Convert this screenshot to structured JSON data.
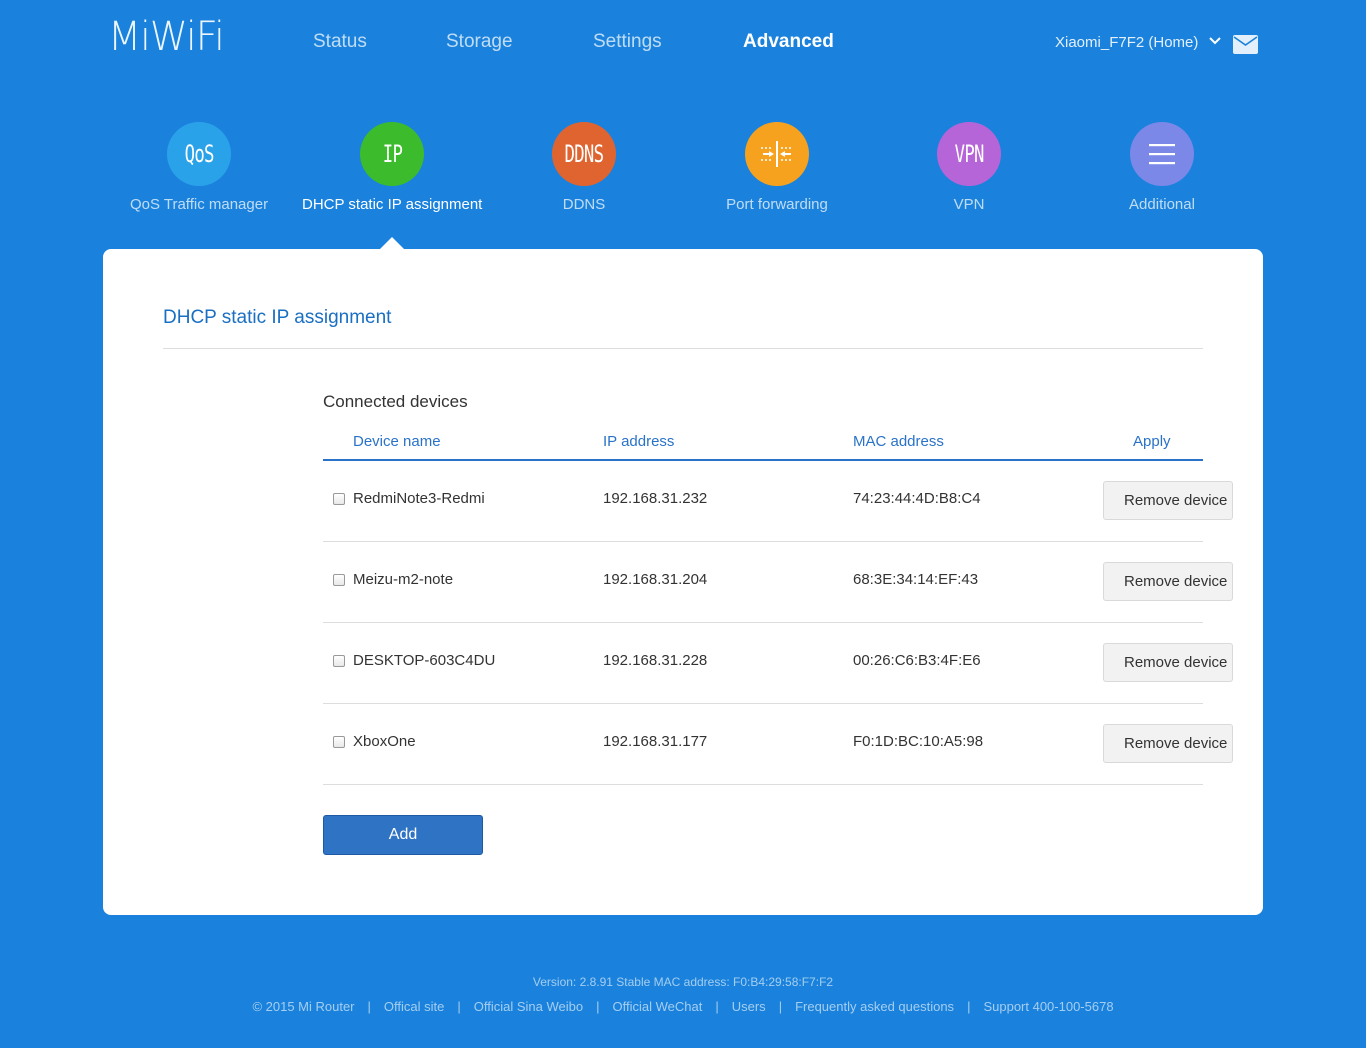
{
  "header": {
    "logo": "MiWiFi",
    "nav": [
      {
        "label": "Status"
      },
      {
        "label": "Storage"
      },
      {
        "label": "Settings"
      },
      {
        "label": "Advanced",
        "active": true
      }
    ],
    "router_name": "Xiaomi_F7F2 (Home)",
    "mail_icon": "mail-icon"
  },
  "features": [
    {
      "icon_text": "QoS",
      "label": "QoS Traffic manager",
      "color": "#2aa2ea"
    },
    {
      "icon_text": "IP",
      "label": "DHCP static IP assignment",
      "color": "#3cbb2c",
      "active": true
    },
    {
      "icon_text": "DDNS",
      "label": "DDNS",
      "color": "#e06430"
    },
    {
      "icon_text": "",
      "label": "Port forwarding",
      "color": "#f7a21f",
      "icon": "port-forwarding-icon"
    },
    {
      "icon_text": "VPN",
      "label": "VPN",
      "color": "#b565d8"
    },
    {
      "icon_text": "",
      "label": "Additional",
      "color": "#7b88e8",
      "icon": "menu-icon"
    }
  ],
  "card": {
    "title": "DHCP static IP assignment",
    "section_title": "Connected devices",
    "columns": [
      "Device name",
      "IP address",
      "MAC address",
      "Apply"
    ],
    "devices": [
      {
        "name": "RedmiNote3-Redmi",
        "ip": "192.168.31.232",
        "mac": "74:23:44:4D:B8:C4",
        "action": "Remove device"
      },
      {
        "name": "Meizu-m2-note",
        "ip": "192.168.31.204",
        "mac": "68:3E:34:14:EF:43",
        "action": "Remove device"
      },
      {
        "name": "DESKTOP-603C4DU",
        "ip": "192.168.31.228",
        "mac": "00:26:C6:B3:4F:E6",
        "action": "Remove device"
      },
      {
        "name": "XboxOne",
        "ip": "192.168.31.177",
        "mac": "F0:1D:BC:10:A5:98",
        "action": "Remove device"
      }
    ],
    "add_label": "Add"
  },
  "footer": {
    "version": "Version: 2.8.91 Stable  MAC address: F0:B4:29:58:F7:F2",
    "copyright": "© 2015 Mi Router",
    "links": [
      "Offical site",
      "Official Sina Weibo",
      "Official WeChat",
      "Users",
      "Frequently asked questions",
      "Support 400-100-5678"
    ]
  },
  "colors": {
    "background": "#1a82dc",
    "accent": "#2a72c8",
    "add_button": "#2f73c5"
  }
}
